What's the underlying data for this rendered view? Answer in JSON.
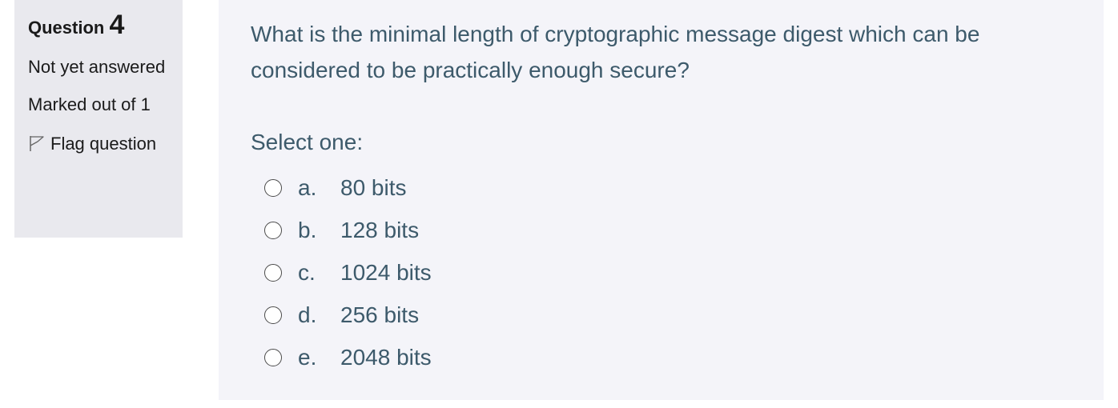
{
  "info": {
    "question_label": "Question",
    "question_number": "4",
    "state": "Not yet answered",
    "grade": "Marked out of 1",
    "flag_label": "Flag question"
  },
  "question": {
    "text": "What is the minimal length of cryptographic message digest which can be considered to be practically enough secure?",
    "prompt": "Select one:",
    "answers": [
      {
        "letter": "a.",
        "label": "80 bits"
      },
      {
        "letter": "b.",
        "label": "128 bits"
      },
      {
        "letter": "c.",
        "label": "1024 bits"
      },
      {
        "letter": "d.",
        "label": "256 bits"
      },
      {
        "letter": "e.",
        "label": "2048 bits"
      }
    ]
  },
  "icons": {
    "flag": "flag-outline-icon",
    "radio": "radio-unchecked-icon"
  }
}
